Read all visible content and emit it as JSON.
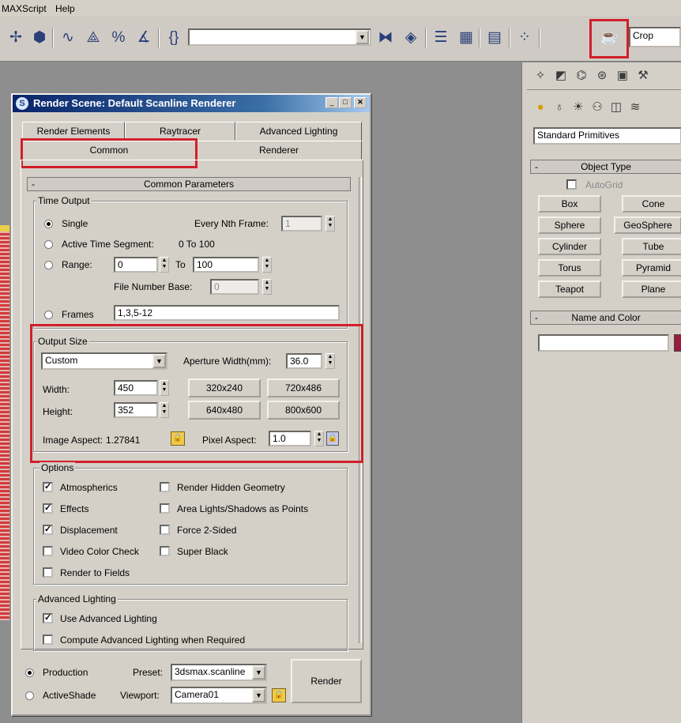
{
  "menu": {
    "maxscript": "MAXScript",
    "help": "Help"
  },
  "toolbar": {
    "named_selection": "",
    "crop_label": "Crop"
  },
  "dialog": {
    "title": "Render Scene: Default Scanline Renderer",
    "tabs_row1": [
      "Render Elements",
      "Raytracer",
      "Advanced Lighting"
    ],
    "tabs_row2": [
      "Common",
      "Renderer"
    ],
    "rollout_title": "Common Parameters",
    "rollout_toggle": "-",
    "time_output": {
      "label": "Time Output",
      "single": "Single",
      "every_nth_label": "Every Nth Frame:",
      "every_nth_value": "1",
      "active_segment": "Active Time Segment:",
      "active_segment_range": "0 To 100",
      "range_label": "Range:",
      "range_from": "0",
      "range_to_label": "To",
      "range_to": "100",
      "file_number_base_label": "File Number Base:",
      "file_number_base": "0",
      "frames_label": "Frames",
      "frames_value": "1,3,5-12"
    },
    "output_size": {
      "label": "Output Size",
      "preset": "Custom",
      "aperture_label": "Aperture Width(mm):",
      "aperture_value": "36.0",
      "width_label": "Width:",
      "width_value": "450",
      "height_label": "Height:",
      "height_value": "352",
      "presets": [
        "320x240",
        "720x486",
        "640x480",
        "800x600"
      ],
      "image_aspect_label": "Image Aspect:",
      "image_aspect_value": "1.27841",
      "pixel_aspect_label": "Pixel Aspect:",
      "pixel_aspect_value": "1.0"
    },
    "options": {
      "label": "Options",
      "items": [
        {
          "label": "Atmospherics",
          "checked": true
        },
        {
          "label": "Render Hidden Geometry",
          "checked": false
        },
        {
          "label": "Effects",
          "checked": true
        },
        {
          "label": "Area Lights/Shadows as Points",
          "checked": false
        },
        {
          "label": "Displacement",
          "checked": true
        },
        {
          "label": "Force 2-Sided",
          "checked": false
        },
        {
          "label": "Video Color Check",
          "checked": false
        },
        {
          "label": "Super Black",
          "checked": false
        },
        {
          "label": "Render to Fields",
          "checked": false
        }
      ]
    },
    "advanced_lighting": {
      "label": "Advanced Lighting",
      "use": "Use Advanced Lighting",
      "use_checked": true,
      "compute": "Compute Advanced Lighting when Required",
      "compute_checked": false
    },
    "bottom": {
      "production": "Production",
      "activeshade": "ActiveShade",
      "preset_label": "Preset:",
      "preset_value": "3dsmax.scanline",
      "viewport_label": "Viewport:",
      "viewport_value": "Camera01",
      "render_button": "Render"
    }
  },
  "command_panel": {
    "category": "Standard Primitives",
    "object_type_title": "Object Type",
    "autogrid": "AutoGrid",
    "buttons": [
      "Box",
      "Cone",
      "Sphere",
      "GeoSphere",
      "Cylinder",
      "Tube",
      "Torus",
      "Pyramid",
      "Teapot",
      "Plane"
    ],
    "name_color_title": "Name and Color",
    "object_name": "",
    "swatch_color": "#9a1c3c",
    "rollout_toggle": "-"
  },
  "colors": {
    "highlight": "#d11f2a",
    "title_bar": "#0a246a",
    "ui_gray": "#d4d0c8"
  }
}
